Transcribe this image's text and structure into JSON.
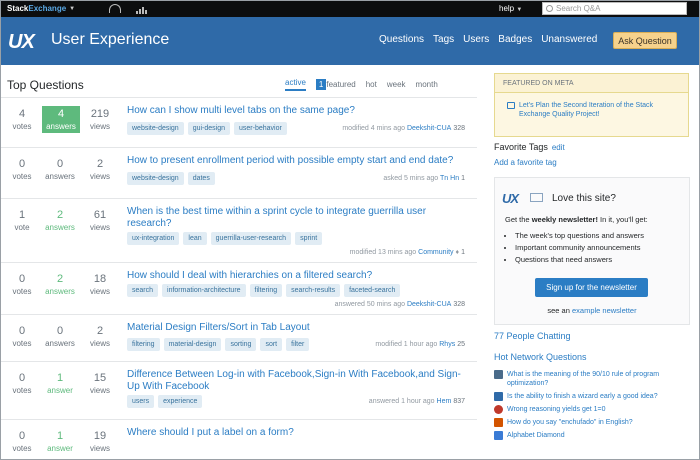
{
  "topbar": {
    "brand_a": "Stack",
    "brand_b": "Exchange",
    "help": "help",
    "search_placeholder": "Search Q&A"
  },
  "header": {
    "logo": "UX",
    "site_name": "User Experience",
    "nav": [
      "Questions",
      "Tags",
      "Users",
      "Badges",
      "Unanswered"
    ],
    "ask_button": "Ask Question",
    "color": "#2f6aa8"
  },
  "main": {
    "title": "Top Questions",
    "tabs": {
      "active": "active",
      "featured_count": "1",
      "featured": "featured",
      "hot": "hot",
      "week": "week",
      "month": "month"
    },
    "questions": [
      {
        "votes": "4",
        "votes_label": "votes",
        "answers": "4",
        "answers_label": "answers",
        "views": "219",
        "views_label": "views",
        "title": "How can I show multi level tabs on the same page?",
        "tags": [
          "website-design",
          "gui-design",
          "user-behavior"
        ],
        "meta": "modified 4 mins ago",
        "user": "Deekshit-CUA",
        "rep": "328"
      },
      {
        "votes": "0",
        "votes_label": "votes",
        "answers": "0",
        "answers_label": "answers",
        "views": "2",
        "views_label": "views",
        "title": "How to present enrollment period with possible empty start and end date?",
        "tags": [
          "website-design",
          "dates"
        ],
        "meta": "asked 5 mins ago",
        "user": "Tn Hn",
        "rep": "1"
      },
      {
        "votes": "1",
        "votes_label": "vote",
        "answers": "2",
        "answers_label": "answers",
        "views": "61",
        "views_label": "views",
        "title": "When is the best time within a sprint cycle to integrate guerrilla user research?",
        "tags": [
          "ux-integration",
          "lean",
          "guerrilla-user-research",
          "sprint"
        ],
        "meta": "modified 13 mins ago",
        "user": "Community",
        "rep": "1"
      },
      {
        "votes": "0",
        "votes_label": "votes",
        "answers": "2",
        "answers_label": "answers",
        "views": "18",
        "views_label": "views",
        "title": "How should I deal with hierarchies on a filtered search?",
        "tags": [
          "search",
          "information-architecture",
          "filtering",
          "search-results",
          "faceted-search"
        ],
        "meta": "answered 50 mins ago",
        "user": "Deekshit-CUA",
        "rep": "328"
      },
      {
        "votes": "0",
        "votes_label": "votes",
        "answers": "0",
        "answers_label": "answers",
        "views": "2",
        "views_label": "views",
        "title": "Material Design Filters/Sort in Tab Layout",
        "tags": [
          "filtering",
          "material-design",
          "sorting",
          "sort",
          "filter"
        ],
        "meta": "modified 1 hour ago",
        "user": "Rhys",
        "rep": "25"
      },
      {
        "votes": "0",
        "votes_label": "votes",
        "answers": "1",
        "answers_label": "answer",
        "views": "15",
        "views_label": "views",
        "title": "Difference Between Log-in with Facebook,Sign-in With Facebook,and Sign-Up With Facebook",
        "tags": [
          "users",
          "experience"
        ],
        "meta": "answered 1 hour ago",
        "user": "Hem",
        "rep": "837"
      },
      {
        "votes": "0",
        "votes_label": "votes",
        "answers": "1",
        "answers_label": "answer",
        "views": "19",
        "views_label": "views",
        "title": "Where should I put a label on a form?",
        "tags": [],
        "meta": "",
        "user": "",
        "rep": ""
      }
    ]
  },
  "sidebar": {
    "featured_header": "FEATURED ON META",
    "featured_item": "Let's Plan the Second Iteration of the Stack Exchange Quality Project!",
    "favorite_tags": "Favorite Tags",
    "edit": "edit",
    "add_favorite": "Add a favorite tag",
    "newsletter": {
      "logo": "UX",
      "love": "Love this site?",
      "get_pre": "Get the ",
      "get_bold": "weekly newsletter!",
      "get_post": " In it, you'll get:",
      "bullets": [
        "The week's top questions and answers",
        "Important community announcements",
        "Questions that need answers"
      ],
      "signup": "Sign up for the newsletter",
      "see": "see an ",
      "example": "example newsletter"
    },
    "people_chatting": "77 People Chatting",
    "hot_network_title": "Hot Network Questions",
    "hot_network": [
      {
        "text": "What is the meaning of the 90/10 rule of program optimization?",
        "icon": "softwareengineering-icon",
        "color": "#4a6b8a"
      },
      {
        "text": "Is the ability to finish a wizard early a good idea?",
        "icon": "ux-icon",
        "color": "#2f6aa8"
      },
      {
        "text": "Wrong reasoning yields get 1=0",
        "icon": "math-icon",
        "color": "#c0392b"
      },
      {
        "text": "How do you say \"enchufado\" in English?",
        "icon": "spanish-icon",
        "color": "#d35400"
      },
      {
        "text": "Alphabet Diamond",
        "icon": "codegolf-icon",
        "color": "#3a7bd5"
      }
    ]
  }
}
